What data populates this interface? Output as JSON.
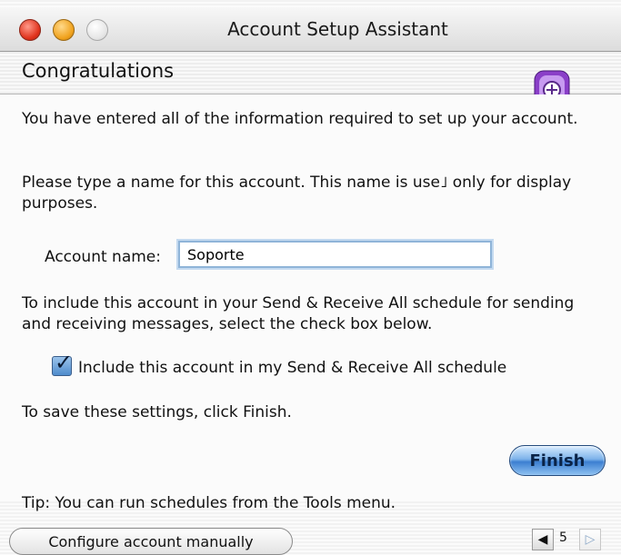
{
  "window": {
    "title": "Account Setup Assistant"
  },
  "header": {
    "heading": "Congratulations",
    "icon": "entourage-app-icon"
  },
  "content": {
    "intro": "You have entered all of the information required to set up your account.",
    "name_instruction": "Please type a name for this account. This name is use˩ only for display purposes.",
    "account_name_label": "Account name:",
    "account_name_value": "Soporte",
    "schedule_instruction": "To include this account in your Send & Receive All schedule for sending and receiving messages, select the check box below.",
    "include_checkbox_label": "Include this account in my Send & Receive All schedule",
    "include_checked": true,
    "save_instruction": "To save these settings, click Finish.",
    "finish_label": "Finish",
    "tip": "Tip: You can run schedules from the Tools menu."
  },
  "footer": {
    "configure_label": "Configure account manually",
    "page_number": "5",
    "prev_icon": "triangle-left-icon",
    "next_icon": "triangle-right-icon"
  },
  "colors": {
    "accent": "#3c7fd1",
    "close": "#e0321c",
    "minimize": "#f0a21d"
  }
}
